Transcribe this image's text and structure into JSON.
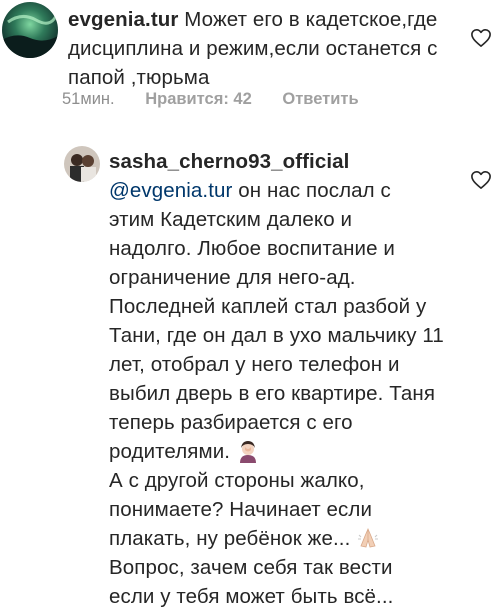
{
  "comments": [
    {
      "username": "evgenia.tur",
      "lines": [
        "Может его в кадетское,где",
        "дисциплина и режим,если останется с",
        "папой ,тюрьма"
      ],
      "time": "51мин.",
      "likes": "Нравится: 42",
      "reply": "Ответить",
      "avatar_icon": "aurora-avatar",
      "like_icon": "heart-outline-icon"
    },
    {
      "username": "sasha_cherno93_official",
      "mention": "@evgenia.tur",
      "first_line_rest": " он нас послал с",
      "lines": [
        "этим Кадетским далеко и",
        "надолго. Любое воспитание и",
        "ограничение для него-ад.",
        "Последней каплей стал разбой у",
        "Тани, где он дал в ухо мальчику 11",
        "лет, отобрал у него телефон и",
        "выбил дверь в его квартире. Таня",
        "теперь разбирается с его",
        "родителями.",
        "А с другой стороны жалко,",
        "понимаете? Начинает если",
        "плакать, ну ребёнок же...",
        "Вопрос, зачем себя так вести",
        "если у тебя может быть всё..."
      ],
      "emoji_after_line_9": "facepalm-woman-emoji",
      "emoji_after_line_12": "praying-hands-emoji",
      "avatar_icon": "couple-photo-avatar",
      "like_icon": "heart-outline-icon"
    }
  ],
  "colors": {
    "text": "#262626",
    "mention": "#00376b",
    "meta": "#8e8e8e"
  }
}
